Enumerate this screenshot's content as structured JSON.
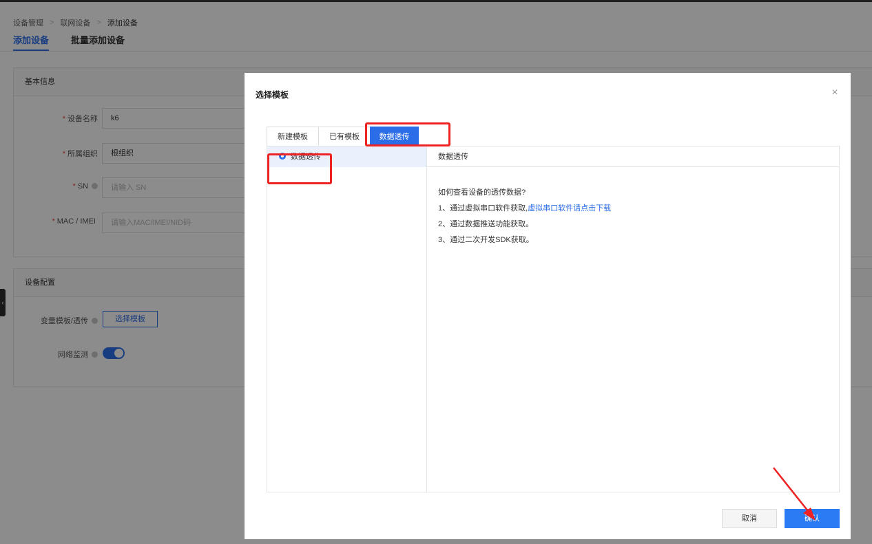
{
  "breadcrumb": {
    "items": [
      "设备管理",
      "联网设备",
      "添加设备"
    ]
  },
  "page_tabs": [
    "添加设备",
    "批量添加设备"
  ],
  "basic_info": {
    "title": "基本信息",
    "device_name": {
      "label": "设备名称",
      "value": "k6"
    },
    "org": {
      "label": "所属组织",
      "value": "根组织"
    },
    "sn": {
      "label": "SN",
      "placeholder": "请输入 SN"
    },
    "mac": {
      "label": "MAC / IMEI",
      "placeholder": "请输入MAC/IMEI/NID码"
    }
  },
  "device_config": {
    "title": "设备配置",
    "template_label": "变量模板/透传",
    "template_button": "选择模板",
    "network_label": "网络监测",
    "network_on": true
  },
  "modal": {
    "title": "选择模板",
    "tabs": [
      "新建模板",
      "已有模板",
      "数据透传"
    ],
    "list_item": "数据透传",
    "detail_title": "数据透传",
    "question": "如何查看设备的透传数据?",
    "step1": "1、通过虚拟串口软件获取,",
    "step1_link": "虚拟串口软件请点击下载",
    "step2": "2、通过数据推送功能获取。",
    "step3": "3、通过二次开发SDK获取。",
    "cancel": "取消",
    "confirm": "确认"
  },
  "colors": {
    "accent": "#2b6de8",
    "annotation": "#ee2222"
  }
}
